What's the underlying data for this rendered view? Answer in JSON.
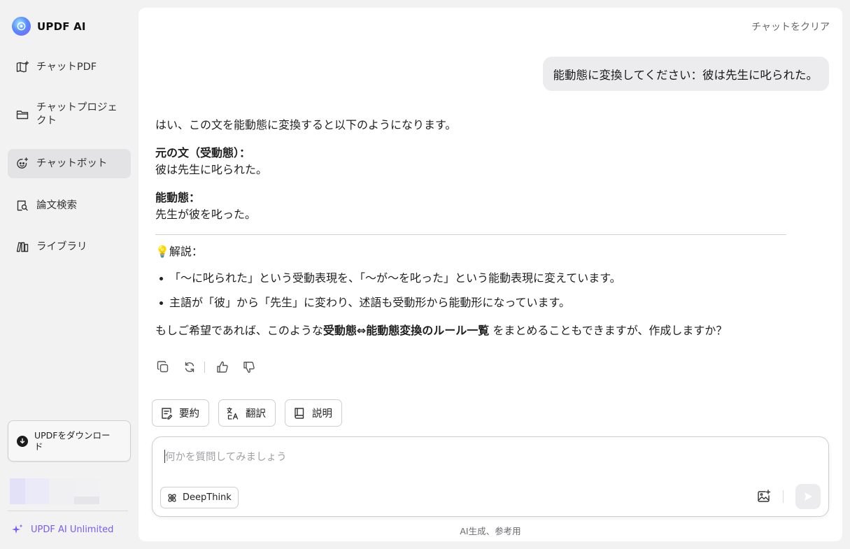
{
  "sidebar": {
    "brand": "UPDF AI",
    "items": [
      {
        "label": "チャットPDF",
        "icon": "chat-pdf-icon"
      },
      {
        "label": "チャットプロジェクト",
        "icon": "folder-icon"
      },
      {
        "label": "チャットボット",
        "icon": "bot-icon"
      },
      {
        "label": "論文検索",
        "icon": "paper-search-icon"
      },
      {
        "label": "ライブラリ",
        "icon": "library-icon"
      }
    ],
    "active_item": "チャットボット",
    "download_label": "UPDFをダウンロード",
    "unlimited_label": "UPDF AI Unlimited"
  },
  "header": {
    "clear_label": "チャットをクリア"
  },
  "chat": {
    "user_message": "能動態に変換してください：彼は先生に叱られた。",
    "answer": {
      "intro": "はい、この文を能動態に変換すると以下のようになります。",
      "original_heading": "元の文（受動態）：",
      "original_text": "彼は先生に叱られた。",
      "active_heading": "能動態：",
      "active_text": "先生が彼を叱った。",
      "explain_emoji": "💡",
      "explain_heading": "解説：",
      "bullets": [
        "「〜に叱られた」という受動表現を、「〜が〜を叱った」という能動表現に変えています。",
        "主語が「彼」から「先生」に変わり、述語も受動形から能動形になっています。"
      ],
      "closing_before": "もしご希望であれば、このような",
      "closing_bold": "受動態⇔能動態変換のルール一覧",
      "closing_after": " をまとめることもできますが、作成しますか？"
    }
  },
  "quick_actions": [
    "要約",
    "翻訳",
    "説明"
  ],
  "input": {
    "placeholder": "何かを質問してみましょう",
    "deepthink_label": "DeepThink"
  },
  "footer": {
    "disclaimer": "AI生成、参考用"
  },
  "colors": {
    "accent": "#7a5cf0",
    "background": "#f2f2f3",
    "panel": "#ffffff"
  }
}
